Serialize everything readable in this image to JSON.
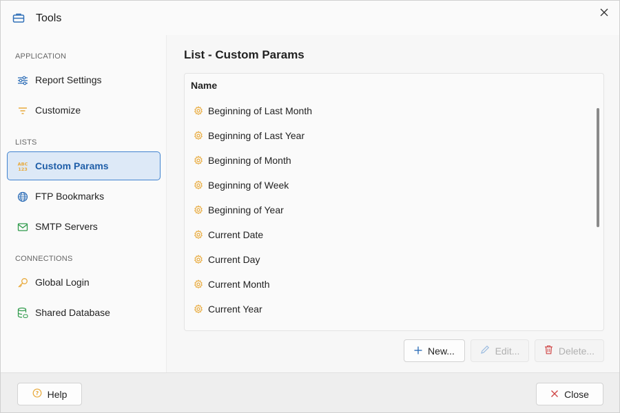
{
  "window": {
    "title": "Tools",
    "app_icon": "toolbox-icon",
    "close_icon": "close-icon"
  },
  "sidebar": {
    "sections": [
      {
        "header": "APPLICATION",
        "items": [
          {
            "label": "Report Settings",
            "icon": "sliders-icon"
          },
          {
            "label": "Customize",
            "icon": "filter-icon"
          }
        ]
      },
      {
        "header": "LISTS",
        "items": [
          {
            "label": "Custom Params",
            "icon": "abc-123-icon",
            "active": true
          },
          {
            "label": "FTP Bookmarks",
            "icon": "globe-icon"
          },
          {
            "label": "SMTP Servers",
            "icon": "mail-icon"
          }
        ]
      },
      {
        "header": "CONNECTIONS",
        "items": [
          {
            "label": "Global Login",
            "icon": "key-icon"
          },
          {
            "label": "Shared Database",
            "icon": "database-link-icon"
          }
        ]
      }
    ]
  },
  "main": {
    "heading": "List - Custom Params",
    "column_header": "Name",
    "rows": [
      "Beginning of Last Month",
      "Beginning of Last Year",
      "Beginning of Month",
      "Beginning of Week",
      "Beginning of Year",
      "Current Date",
      "Current Day",
      "Current Month",
      "Current Year"
    ],
    "buttons": {
      "new": "New...",
      "edit": "Edit...",
      "delete": "Delete..."
    }
  },
  "footer": {
    "help": "Help",
    "close": "Close"
  },
  "colors": {
    "accent": "#3f82cf",
    "active_bg": "#dde9f7",
    "gear": "#e8a93a",
    "delete_icon": "#d04848",
    "close_x": "#d04848"
  }
}
